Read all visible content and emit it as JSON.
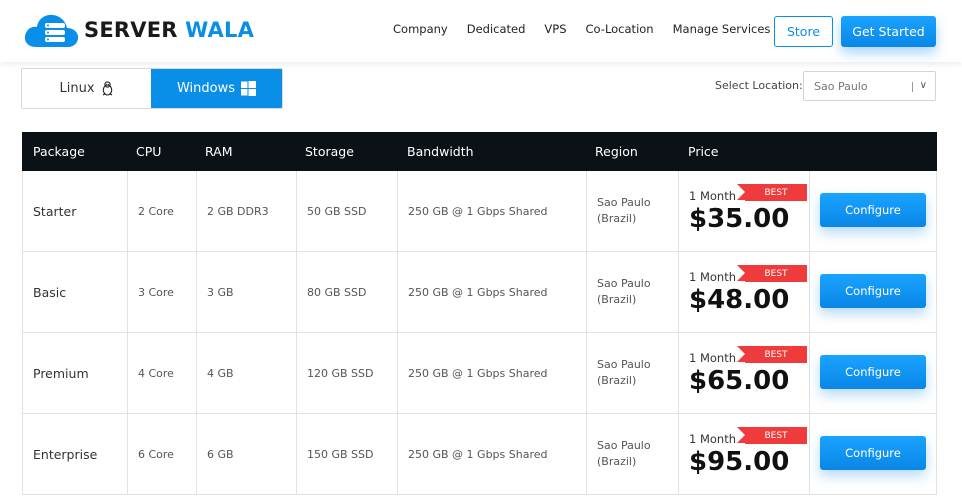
{
  "brand": {
    "name_part1": "SERVER",
    "name_part2": "WALA",
    "color_accent": "#0a8fe8"
  },
  "nav": {
    "items": [
      "Company",
      "Dedicated",
      "VPS",
      "Co-Location",
      "Manage Services"
    ]
  },
  "header_buttons": {
    "store": "Store",
    "get_started": "Get Started"
  },
  "os_toggle": {
    "linux": "Linux",
    "windows": "Windows",
    "selected": "Windows"
  },
  "location": {
    "label": "Select Location:",
    "selected": "Sao Paulo"
  },
  "table": {
    "headers": [
      "Package",
      "CPU",
      "RAM",
      "Storage",
      "Bandwidth",
      "Region",
      "Price"
    ],
    "rows": [
      {
        "package": "Starter",
        "cpu": "2 Core",
        "ram": "2 GB DDR3",
        "storage": "50 GB SSD",
        "bandwidth": "250 GB @ 1 Gbps Shared",
        "region_city": "Sao Paulo",
        "region_country": "(Brazil)",
        "term": "1 Month",
        "badge": "BEST",
        "price": "$35.00",
        "action": "Configure"
      },
      {
        "package": "Basic",
        "cpu": "3 Core",
        "ram": "3 GB",
        "storage": "80 GB SSD",
        "bandwidth": "250 GB @ 1 Gbps Shared",
        "region_city": "Sao Paulo",
        "region_country": "(Brazil)",
        "term": "1 Month",
        "badge": "BEST",
        "price": "$48.00",
        "action": "Configure"
      },
      {
        "package": "Premium",
        "cpu": "4 Core",
        "ram": "4 GB",
        "storage": "120 GB SSD",
        "bandwidth": "250 GB @ 1 Gbps Shared",
        "region_city": "Sao Paulo",
        "region_country": "(Brazil)",
        "term": "1 Month",
        "badge": "BEST",
        "price": "$65.00",
        "action": "Configure"
      },
      {
        "package": "Enterprise",
        "cpu": "6 Core",
        "ram": "6 GB",
        "storage": "150 GB SSD",
        "bandwidth": "250 GB @ 1 Gbps Shared",
        "region_city": "Sao Paulo",
        "region_country": "(Brazil)",
        "term": "1 Month",
        "badge": "BEST",
        "price": "$95.00",
        "action": "Configure"
      }
    ]
  }
}
